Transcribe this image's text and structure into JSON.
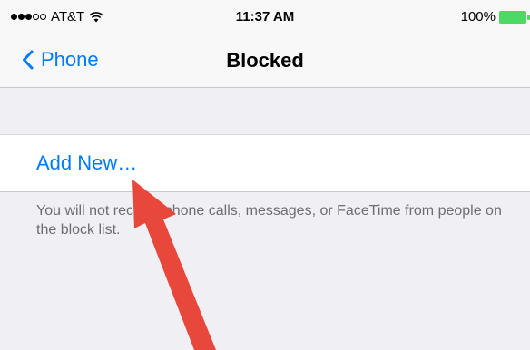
{
  "status_bar": {
    "carrier": "AT&T",
    "time": "11:37 AM",
    "battery_percent": "100%",
    "signal_bars_filled": 3,
    "signal_bars_total": 5
  },
  "nav": {
    "back_label": "Phone",
    "title": "Blocked"
  },
  "list": {
    "add_new_label": "Add New…"
  },
  "footer": {
    "note": "You will not receive phone calls, messages, or FaceTime from people on the block list."
  },
  "colors": {
    "accent": "#007aff",
    "battery": "#4cd964",
    "annotation_arrow": "#e8473c"
  },
  "icons": [
    "wifi-icon",
    "battery-icon",
    "chevron-left-icon",
    "annotation-arrow"
  ]
}
